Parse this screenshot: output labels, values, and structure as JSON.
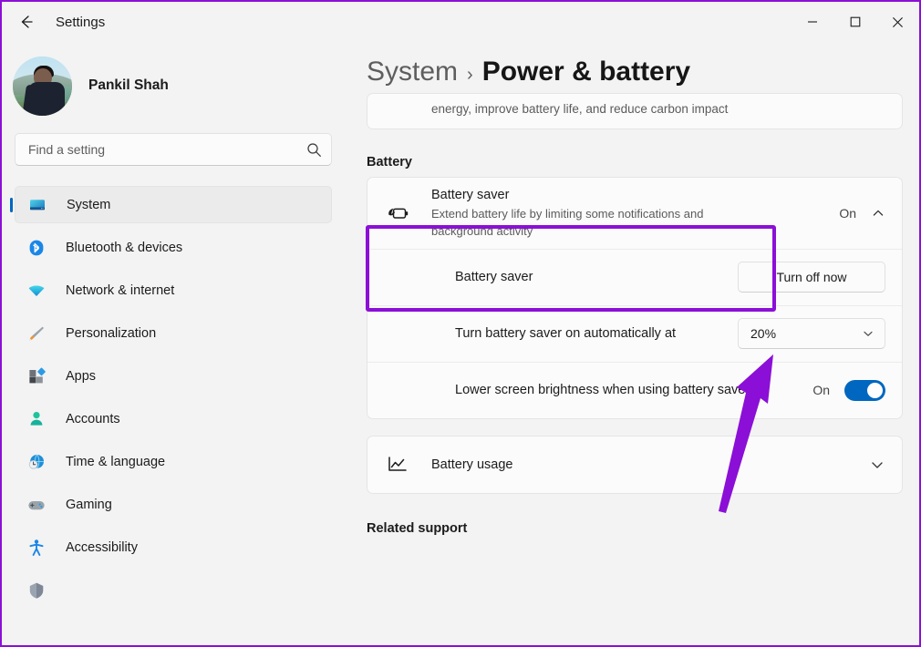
{
  "window": {
    "title": "Settings",
    "back_icon": "back-arrow-icon",
    "minimize_label": "—",
    "maximize_label": "□",
    "close_label": "✕"
  },
  "sidebar": {
    "profile": {
      "name": "Pankil Shah",
      "avatar_icon": "user-avatar-photo"
    },
    "search": {
      "placeholder": "Find a setting",
      "value": "",
      "icon": "search-icon"
    },
    "items": [
      {
        "label": "System",
        "icon": "monitor-icon",
        "selected": true
      },
      {
        "label": "Bluetooth & devices",
        "icon": "bluetooth-icon",
        "selected": false
      },
      {
        "label": "Network & internet",
        "icon": "wifi-icon",
        "selected": false
      },
      {
        "label": "Personalization",
        "icon": "paintbrush-icon",
        "selected": false
      },
      {
        "label": "Apps",
        "icon": "apps-icon",
        "selected": false
      },
      {
        "label": "Accounts",
        "icon": "person-icon",
        "selected": false
      },
      {
        "label": "Time & language",
        "icon": "globe-clock-icon",
        "selected": false
      },
      {
        "label": "Gaming",
        "icon": "gamepad-icon",
        "selected": false
      },
      {
        "label": "Accessibility",
        "icon": "accessibility-icon",
        "selected": false
      },
      {
        "label": "",
        "icon": "shield-icon",
        "selected": false
      }
    ]
  },
  "main": {
    "breadcrumb": {
      "root": "System",
      "separator": "›",
      "current": "Power & battery"
    },
    "scrolled_card": {
      "visible_line": "energy, improve battery life, and reduce carbon impact"
    },
    "battery_section": {
      "heading": "Battery",
      "battery_saver": {
        "title": "Battery saver",
        "subtitle": "Extend battery life by limiting some notifications and background activity",
        "icon": "battery-saver-icon",
        "status": "On",
        "expand_icon": "chevron-up-icon"
      },
      "sub_rows": [
        {
          "title": "Battery saver",
          "control": "button",
          "button_label": "Turn off now"
        },
        {
          "title": "Turn battery saver on automatically at",
          "control": "select",
          "select_value": "20%",
          "select_icon": "chevron-down-icon"
        },
        {
          "title": "Lower screen brightness when using battery saver",
          "control": "toggle",
          "toggle_state": "On",
          "toggle_label": "On"
        }
      ],
      "battery_usage": {
        "title": "Battery usage",
        "icon": "line-chart-icon",
        "expand_icon": "chevron-down-icon"
      }
    },
    "related_support_heading": "Related support"
  },
  "annotations": {
    "highlight_color": "#8b0fd6",
    "arrow_color": "#8b0fd6",
    "highlight_target": "battery-saver-row",
    "arrow_target": "turn-off-now-button"
  },
  "colors": {
    "accent": "#0067c0",
    "window_bg": "#f3f3f3",
    "card_bg": "#fbfbfb",
    "annotation_purple": "#8b0fd6"
  }
}
